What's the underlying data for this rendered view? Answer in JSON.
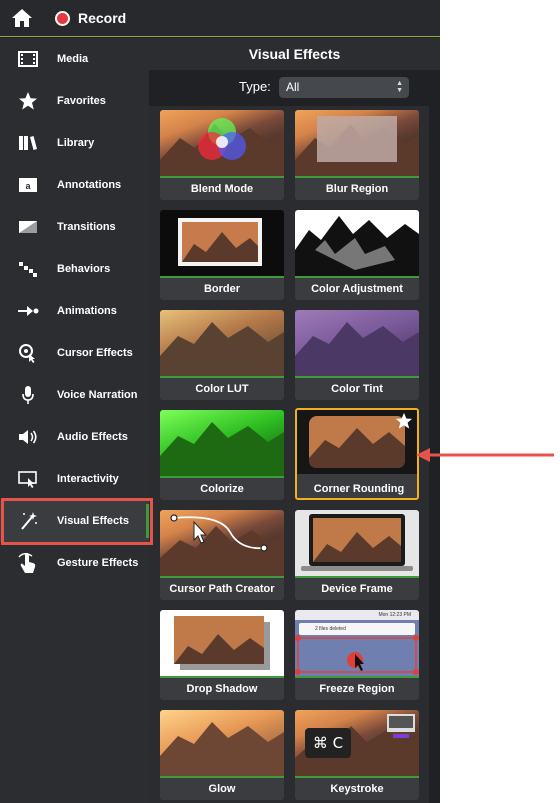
{
  "topbar": {
    "record_label": "Record"
  },
  "sidebar": {
    "items": [
      {
        "label": "Media",
        "icon": "film-icon"
      },
      {
        "label": "Favorites",
        "icon": "star-icon"
      },
      {
        "label": "Library",
        "icon": "books-icon"
      },
      {
        "label": "Annotations",
        "icon": "annotation-icon"
      },
      {
        "label": "Transitions",
        "icon": "transition-icon"
      },
      {
        "label": "Behaviors",
        "icon": "behaviors-icon"
      },
      {
        "label": "Animations",
        "icon": "animation-arrow-icon"
      },
      {
        "label": "Cursor Effects",
        "icon": "cursor-icon"
      },
      {
        "label": "Voice Narration",
        "icon": "microphone-icon"
      },
      {
        "label": "Audio Effects",
        "icon": "speaker-icon"
      },
      {
        "label": "Interactivity",
        "icon": "interactivity-icon"
      },
      {
        "label": "Visual Effects",
        "icon": "magic-wand-icon",
        "active": true
      },
      {
        "label": "Gesture Effects",
        "icon": "hand-gesture-icon"
      }
    ]
  },
  "main": {
    "title": "Visual Effects",
    "type_label": "Type:",
    "type_value": "All",
    "tiles": [
      {
        "label": "Blend Mode"
      },
      {
        "label": "Blur Region"
      },
      {
        "label": "Border"
      },
      {
        "label": "Color Adjustment"
      },
      {
        "label": "Color LUT"
      },
      {
        "label": "Color Tint"
      },
      {
        "label": "Colorize"
      },
      {
        "label": "Corner Rounding",
        "selected": true,
        "favorite": true
      },
      {
        "label": "Cursor Path Creator"
      },
      {
        "label": "Device Frame"
      },
      {
        "label": "Drop Shadow"
      },
      {
        "label": "Freeze Region"
      },
      {
        "label": "Glow"
      },
      {
        "label": "Keystroke"
      }
    ],
    "freeze_thumb": {
      "time": "Mon 12:23 PM",
      "notice": "2 files deleted"
    },
    "keystroke_thumb": {
      "keys": "⌘ C"
    }
  },
  "colors": {
    "accent_green": "#3f9a3b",
    "highlight_red": "#e5534b",
    "selected_gold": "#f3b01c"
  }
}
